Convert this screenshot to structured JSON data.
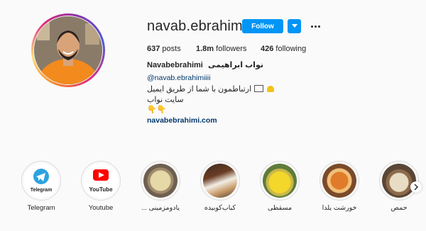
{
  "profile": {
    "username": "navab.ebrahimiii",
    "follow_label": "Follow",
    "stats": {
      "posts_count": "637",
      "posts_label": "posts",
      "followers_count": "1.8m",
      "followers_label": "followers",
      "following_count": "426",
      "following_label": "following"
    },
    "full_name_latin": "Navabebrahimi",
    "full_name_fa": "نواب ابراهیمی",
    "mention": "@navab.ebrahimiiii",
    "bio_line1": "ارتباطمون با شما از طریق ایمیل",
    "bio_line2": "سایت نواب",
    "bio_line3": "👇👇",
    "website": "navabebrahimi.com"
  },
  "highlights": [
    {
      "label": "Telegram",
      "icon_text": "Telegram"
    },
    {
      "label": "Youtube",
      "icon_text": "YouTube"
    },
    {
      "label": "... یادومزمینی"
    },
    {
      "label": "کباب‌کوبیده"
    },
    {
      "label": "مسقطی"
    },
    {
      "label": "خورشت یلدا"
    },
    {
      "label": "حمص"
    }
  ],
  "colors": {
    "accent": "#0095f6",
    "link": "#00376b"
  }
}
